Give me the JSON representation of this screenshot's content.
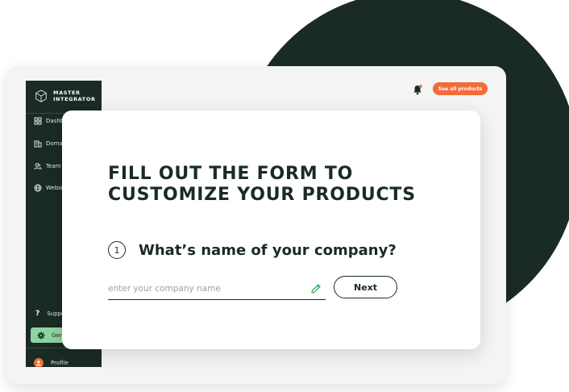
{
  "brand": {
    "name": "MASTER\nINTEGRATOR"
  },
  "sidebar": {
    "items": [
      {
        "label": "Dashboard",
        "icon": "dashboard-icon"
      },
      {
        "label": "Domains",
        "icon": "building-icon"
      },
      {
        "label": "Team",
        "icon": "team-icon"
      },
      {
        "label": "Website",
        "icon": "globe-icon"
      }
    ],
    "support": {
      "label": "Support",
      "icon": "question-icon"
    },
    "general": {
      "label": "General",
      "icon": "gear-icon"
    },
    "profile": {
      "label": "Profile",
      "icon": "avatar-icon"
    }
  },
  "header": {
    "see_all_label": "See all products",
    "notification_icon": "bell-icon"
  },
  "form": {
    "title": "FILL OUT THE FORM TO\nCUSTOMIZE YOUR PRODUCTS",
    "step_number": "1",
    "question": "What’s name of your company?",
    "input_value": "",
    "input_placeholder": "enter your company name",
    "next_label": "Next"
  },
  "colors": {
    "dark_green": "#1a2b23",
    "accent_orange": "#f26b3a",
    "active_green": "#8fd4a0",
    "edit_green": "#3fb86a"
  }
}
